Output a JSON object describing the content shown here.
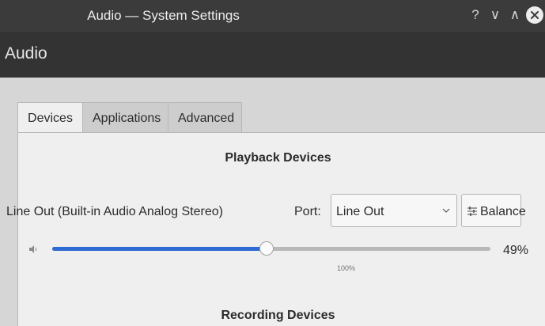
{
  "window": {
    "title": "Audio — System Settings",
    "controls": {
      "help": "?",
      "minimize": "∨",
      "maximize": "∧"
    }
  },
  "header": {
    "title": "Audio"
  },
  "tabs": [
    {
      "label": "Devices",
      "active": true
    },
    {
      "label": "Applications",
      "active": false
    },
    {
      "label": "Advanced",
      "active": false
    }
  ],
  "playback": {
    "heading": "Playback Devices",
    "device_name": "Line Out (Built-in Audio Analog Stereo)",
    "port_label": "Port:",
    "port_value": "Line Out",
    "balance_label": "Balance",
    "volume_percent_label": "49%",
    "volume_fraction": 0.49,
    "mark_100_label": "100%",
    "accent_color": "#2e6ad4"
  },
  "recording": {
    "heading": "Recording Devices"
  },
  "icons": {
    "speaker": "speaker-volume-icon",
    "balance": "sliders-icon",
    "close": "close-icon",
    "dropdown": "chevron-down-icon"
  }
}
